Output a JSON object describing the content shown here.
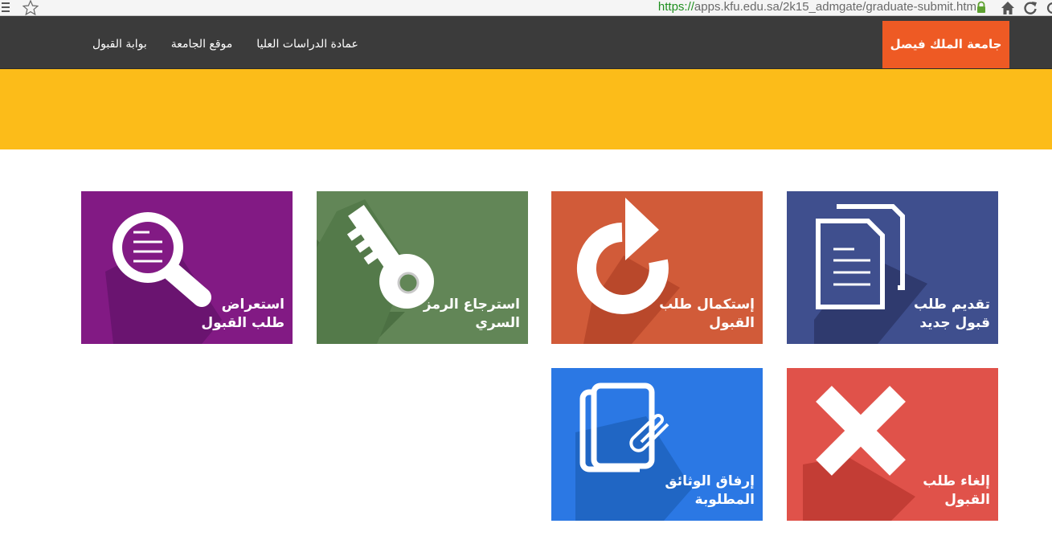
{
  "browser": {
    "url_scheme": "https://",
    "url_host": "apps.kfu.edu.sa",
    "url_path": "/2k15_admgate/graduate-submit.htm"
  },
  "navbar": {
    "brand": "جامعة الملك فيصل",
    "links": [
      "بوابة القبول",
      "موقع الجامعة",
      "عمادة الدراسات العليا"
    ]
  },
  "tiles": [
    {
      "line1": "تقديم طلب",
      "line2": "قبول جديد",
      "color": "#3f4f8e",
      "icon": "documents-icon"
    },
    {
      "line1": "إستكمال طلب",
      "line2": "القبول",
      "color": "#d15b39",
      "icon": "refresh-arrow-icon"
    },
    {
      "line1": "استرجاع الرمز",
      "line2": "السري",
      "color": "#628657",
      "icon": "key-icon"
    },
    {
      "line1": "استعراض",
      "line2": "طلب القبول",
      "color": "#821a84",
      "icon": "magnifier-icon"
    },
    {
      "line1": "إلغاء طلب",
      "line2": "القبول",
      "color": "#e0524a",
      "icon": "cross-icon"
    },
    {
      "line1": "إرفاق الوثائق",
      "line2": "المطلوبة",
      "color": "#2b78e4",
      "icon": "paperclip-document-icon"
    }
  ]
}
